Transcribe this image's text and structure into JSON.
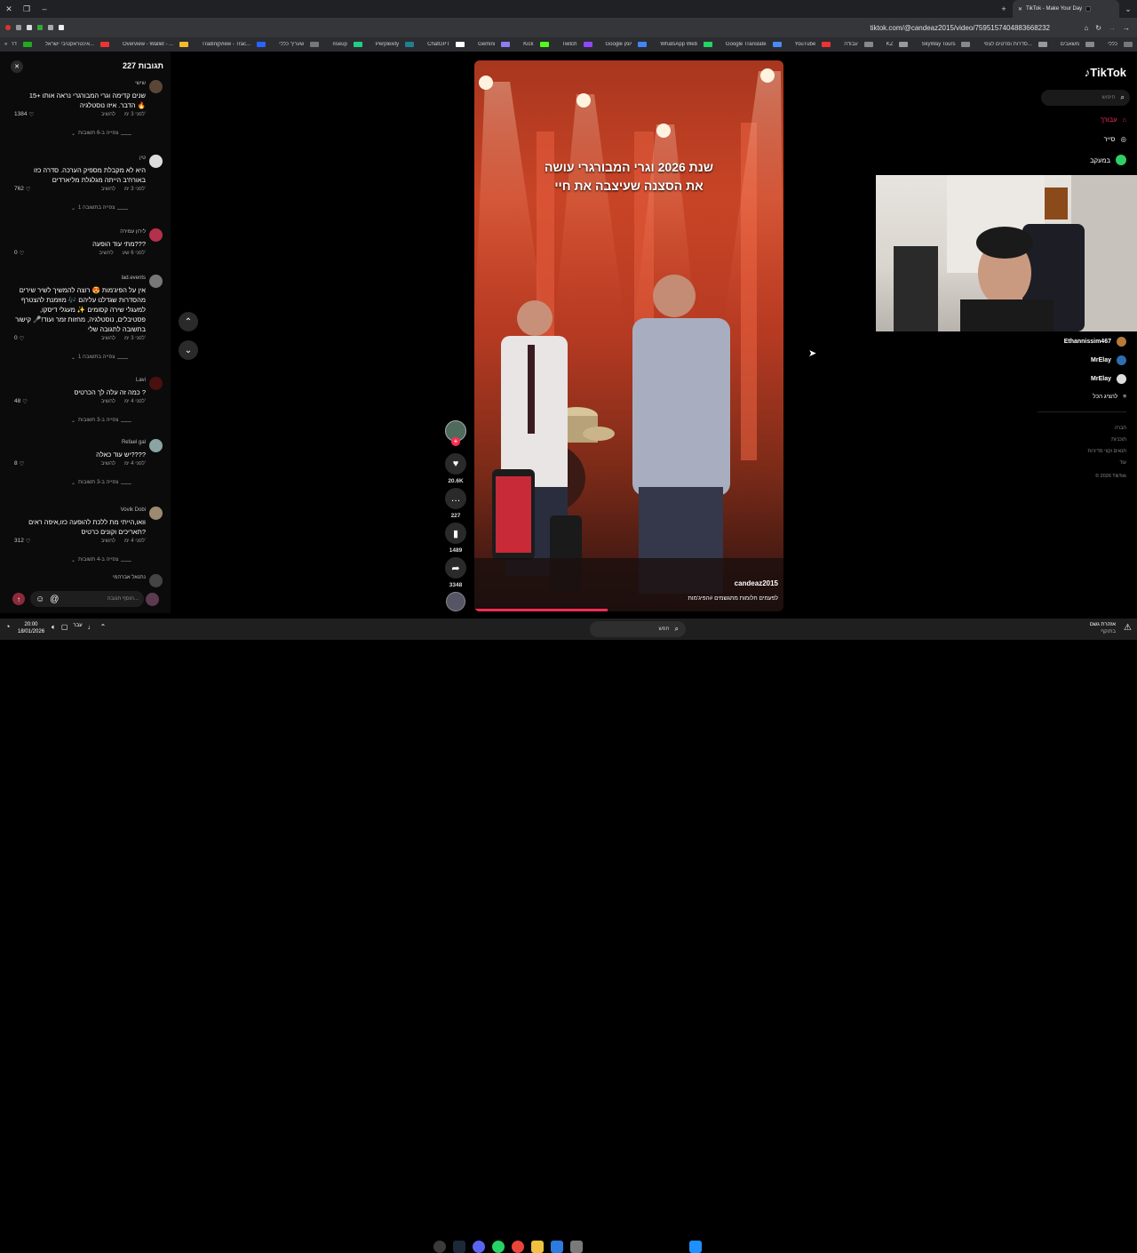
{
  "browser": {
    "tab_title": "TikTok - Make Your Day",
    "url": "tiktok.com/@candeaz2015/video/7595157404883668232",
    "bookmarks": [
      "כללי",
      "משאבים",
      "סדרות וסרטים לצפי...",
      "SkyWay Tours",
      "KZ",
      "עבודה",
      "YouTube",
      "Google Translate",
      "WhatsApp Web",
      "Google יומן",
      "Twitch",
      "Kick",
      "Gemini",
      "ChatGPT",
      "Perplexity",
      "riseup",
      "שעריך כללי",
      "TradingView - Trac...",
      "Overview - Wallet - ...",
      "אינטראקטיבי ישראל...",
      "דרך בכר - דיווח דיווח",
      "הכללת כלי הבינה המ..."
    ]
  },
  "comments": {
    "title": "227 תגובות",
    "reply_label": "להשיב",
    "items": [
      {
        "user": "שישי",
        "text": "15+ שנים קדימה וגרי המבורגרי נראה אותו הדבר. איזו נוסטלגיה 🔥",
        "time": "לפני 3 ימ'",
        "likes": "1384",
        "more": "צפייה ב-6 תשובות",
        "color": "#5a4636"
      },
      {
        "user": "טין",
        "text": "היא לא מקבלת מספיק הערכה. סדרה כזו באורח'ב הייתה מגלגלת מליארדים",
        "time": "לפני 3 ימ'",
        "likes": "762",
        "more": "צפייה בתשובה 1",
        "color": "#dddddd"
      },
      {
        "user": "לירון עמירה",
        "text": "מתי עוד הופעה???",
        "time": "לפני 6 שע'",
        "likes": "0",
        "more": "",
        "color": "#b5304a"
      },
      {
        "user": "lad.events",
        "text": "אין על הפיג'מות 😍 רוצה להמשיך לשיר שירים מהסדרות שגדלנו עליהם 🎶 מוזמנת להצטרף למעגלי שירה קסומים ✨ מעגלי דיסקו, פסטיבלים, נוסטלגיה, מחזות זמר ועוד!🎤 קישור בתשובה לתגובה שלי",
        "time": "לפני 3 ימ'",
        "likes": "0",
        "more": "צפייה בתשובה 1",
        "color": "#777777"
      },
      {
        "user": "Lavi",
        "text": "כמה זה עלה לך הכרטיס ?",
        "time": "לפני 4 ימ'",
        "likes": "48",
        "more": "צפייה ב-3 תשובות",
        "color": "#4a1010"
      },
      {
        "user": "Refael gal",
        "text": "יש עוד כאלה????",
        "time": "לפני 4 ימ'",
        "likes": "8",
        "more": "צפייה ב-3 תשובות",
        "color": "#8aa3a3"
      },
      {
        "user": "Vovik Dobi",
        "text": "וואו,הייתי מת ללכת להופעה כזו,איפה ראים תאריכים וקונים כרטיס?",
        "time": "לפני 4 ימ'",
        "likes": "312",
        "more": "צפייה ב-4 תשובות",
        "color": "#9c8a70"
      },
      {
        "user": "נתנאל אברהמי",
        "text": "",
        "time": "",
        "likes": "",
        "more": "",
        "color": "#444444"
      }
    ],
    "input_placeholder": "הוסף תגובה...",
    "at_symbol": "@"
  },
  "video": {
    "overlay_line1": "שנת 2026 וגרי המבורגרי עושה",
    "overlay_line2": "את הסצנה שעיצבה את חיי",
    "author": "candeaz2015",
    "caption": "לפעמים חלומות מתגשמים #הפיג'מות"
  },
  "actions": {
    "likes": "20.6K",
    "comments": "227",
    "saves": "1489",
    "shares": "3348"
  },
  "sidebar": {
    "logo": "TikTok",
    "search_placeholder": "חיפוש",
    "nav": [
      "עבורך",
      "סייר",
      "במעקב"
    ],
    "following": [
      "Ethannissim467",
      "MrElay",
      "MrElay"
    ],
    "show_all": "להציג הכל",
    "footer": [
      "חברה",
      "תוכניות",
      "תנאים וקווי מדיניות",
      "עוד"
    ],
    "copyright": "© 2026 TikTok"
  },
  "taskbar": {
    "time": "20:00",
    "date": "18/01/2026",
    "search_placeholder": "חפש",
    "weather": "אזהרת גשם",
    "weather_sub": "בתוקף",
    "lang": "עבר"
  },
  "colors": {
    "accent": "#fe2c55",
    "panel": "#0b0b0b",
    "video_red": "#c94426"
  }
}
